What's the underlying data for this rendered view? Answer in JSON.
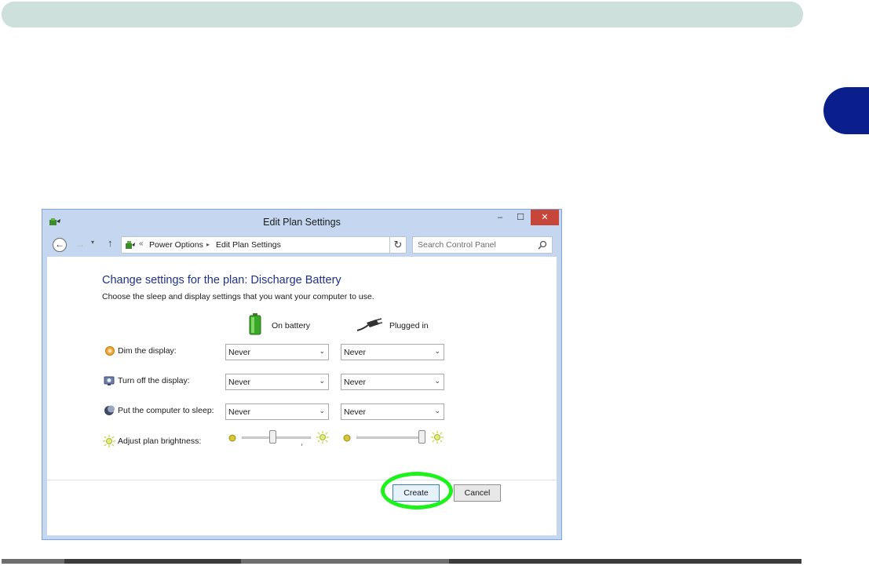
{
  "window": {
    "title": "Edit Plan Settings",
    "minimize": "–",
    "maximize": "☐",
    "close": "✕"
  },
  "address": {
    "back": "←",
    "forward": "→",
    "recent": "▾",
    "up": "↑",
    "chevrons": "«",
    "crumbs": [
      "Power Options",
      "Edit Plan Settings"
    ],
    "separator": "▸",
    "dropdown": "⌄",
    "refresh": "↻",
    "search_placeholder": "Search Control Panel"
  },
  "content": {
    "heading": "Change settings for the plan: Discharge Battery",
    "subtext": "Choose the sleep and display settings that you want your computer to use.",
    "columns": {
      "battery": "On battery",
      "plugged": "Plugged in"
    },
    "rows": [
      {
        "label": "Dim the display:",
        "icon": "dim-display-icon",
        "battery": "Never",
        "plugged": "Never"
      },
      {
        "label": "Turn off the display:",
        "icon": "monitor-icon",
        "battery": "Never",
        "plugged": "Never"
      },
      {
        "label": "Put the computer to sleep:",
        "icon": "moon-icon",
        "battery": "Never",
        "plugged": "Never"
      }
    ],
    "brightness": {
      "label": "Adjust plan brightness:",
      "battery_level": 0.45,
      "plugged_level": 0.95
    },
    "buttons": {
      "create": "Create",
      "cancel": "Cancel"
    }
  },
  "colors": {
    "highlight": "#1df21d",
    "chapter_tab": "#0b1f8c",
    "heading": "#1e3287"
  }
}
